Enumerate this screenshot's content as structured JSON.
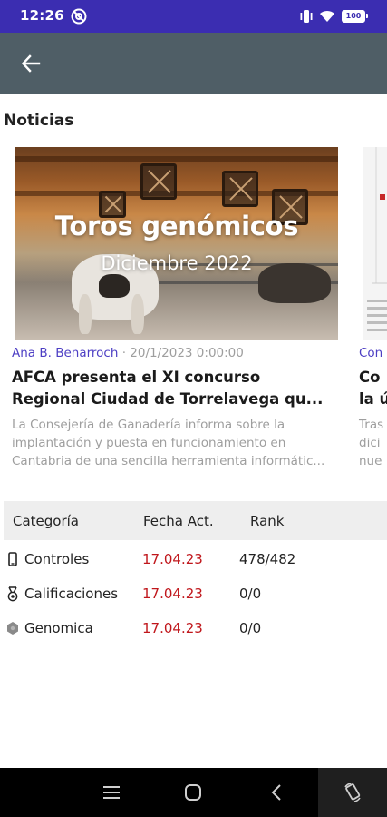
{
  "status_bar": {
    "time": "12:26",
    "battery": "100",
    "accent_color": "#3b2db1"
  },
  "app_bar": {
    "color": "#4f5e66",
    "back_icon": "arrow-back-icon"
  },
  "news": {
    "section_title": "Noticias",
    "cards": [
      {
        "image_title": "Toros genómicos",
        "image_subtitle": "Diciembre 2022",
        "author": "Ana B. Benarroch",
        "separator": "·",
        "date": "20/1/2023 0:00:00",
        "title_line1": "AFCA presenta el XI concurso",
        "title_line2": "Regional Ciudad de Torrelavega qu...",
        "body_line1": "La Consejería de Ganadería informa sobre la",
        "body_line2": "implantación y puesta en funcionamiento en",
        "body_line3": "Cantabria de una sencilla herramienta informátic..."
      },
      {
        "author": "Con",
        "title_line1": "Co",
        "title_line2": "la ú",
        "body_line1": "Tras",
        "body_line2": "dici",
        "body_line3": "nue"
      }
    ]
  },
  "table": {
    "headers": {
      "category": "Categoría",
      "date": "Fecha Act.",
      "rank": "Rank"
    },
    "rows": [
      {
        "icon": "phone-icon",
        "label": "Controles",
        "date": "17.04.23",
        "rank": "478/482"
      },
      {
        "icon": "medal-icon",
        "label": "Calificaciones",
        "date": "17.04.23",
        "rank": "0/0"
      },
      {
        "icon": "dna-icon",
        "label": "Genomica",
        "date": "17.04.23",
        "rank": "0/0"
      }
    ],
    "date_color": "#c0171c"
  },
  "nav_bar": {
    "buttons": [
      "recents-icon",
      "home-icon",
      "back-icon",
      "rotate-icon"
    ]
  }
}
